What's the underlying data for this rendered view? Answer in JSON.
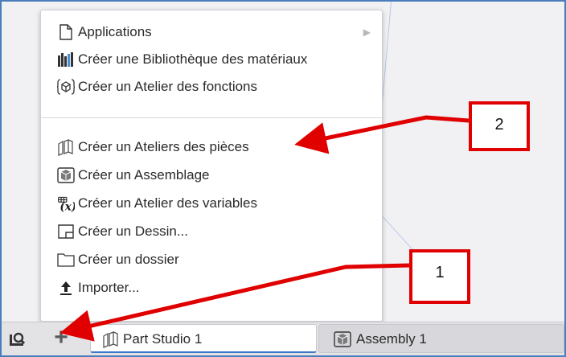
{
  "menu": {
    "items": [
      {
        "label": "Applications",
        "icon": "document-icon",
        "has_submenu": true
      },
      {
        "label": "Créer une Bibliothèque des matériaux",
        "icon": "books-icon"
      },
      {
        "label": "Créer un Atelier des fonctions",
        "icon": "feature-cube-icon"
      },
      {
        "label": "Créer un Ateliers des pièces",
        "icon": "part-studio-icon"
      },
      {
        "label": "Créer un Assemblage",
        "icon": "assembly-icon"
      },
      {
        "label": "Créer un Atelier des variables",
        "icon": "variable-icon"
      },
      {
        "label": "Créer un Dessin...",
        "icon": "drawing-icon"
      },
      {
        "label": "Créer un dossier",
        "icon": "folder-icon"
      },
      {
        "label": "Importer...",
        "icon": "upload-icon"
      }
    ]
  },
  "tabs": [
    {
      "label": "Part Studio 1",
      "icon": "part-studio-icon",
      "active": true
    },
    {
      "label": "Assembly 1",
      "icon": "assembly-icon",
      "active": false
    }
  ],
  "callouts": [
    {
      "label": "1"
    },
    {
      "label": "2"
    }
  ],
  "colors": {
    "annotation": "#e00000",
    "active_tab_border": "#3c78c8",
    "frame_border": "#4a7ebb"
  }
}
